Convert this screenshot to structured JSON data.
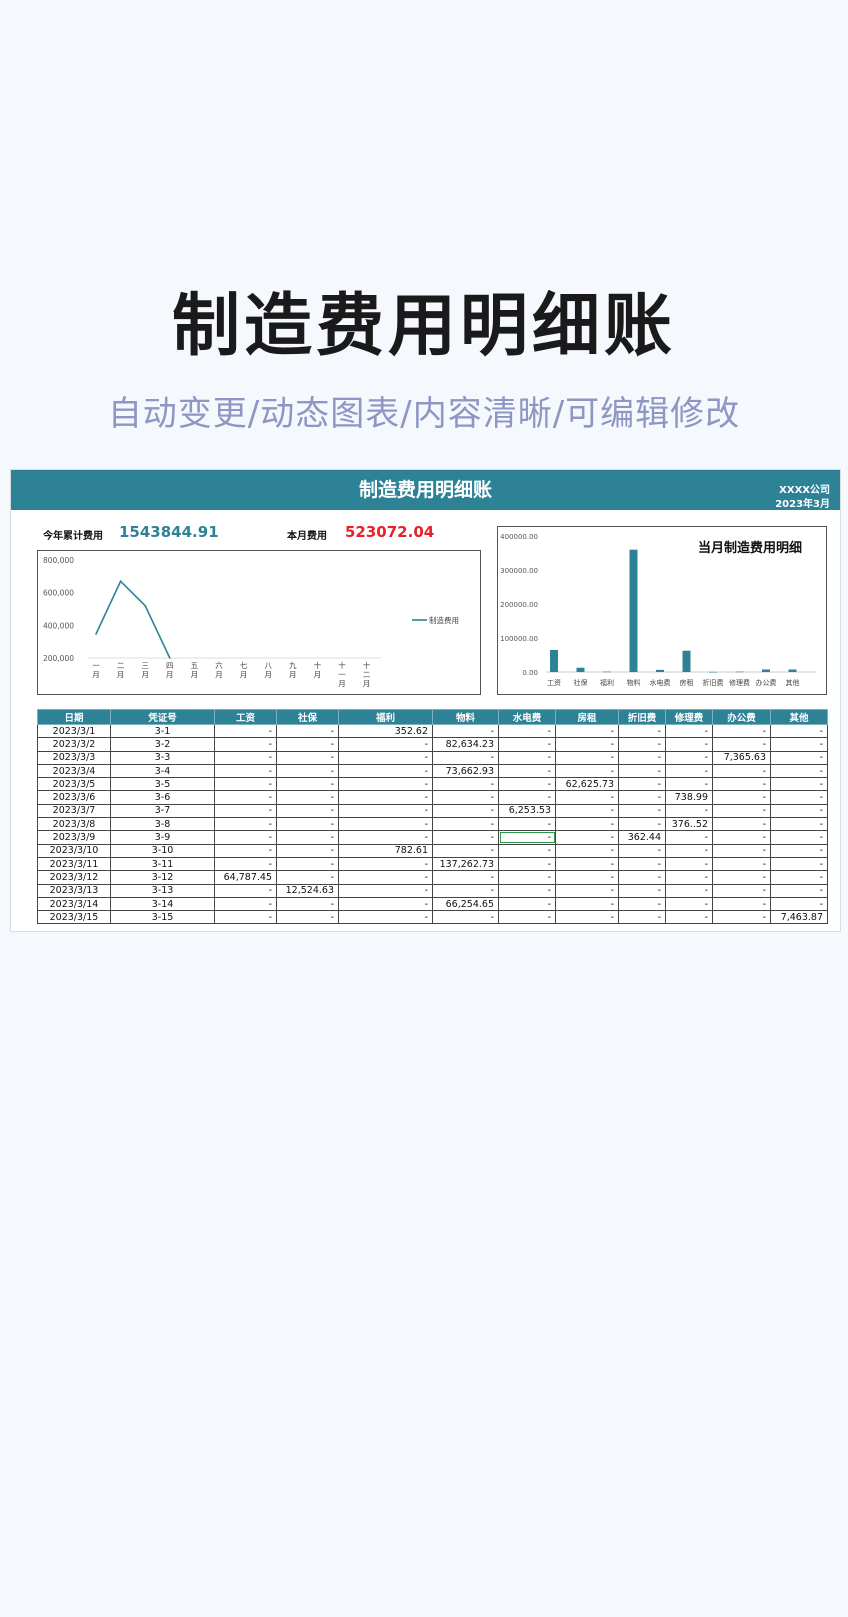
{
  "hero": {
    "title": "制造费用明细账",
    "subtitle": "自动变更/动态图表/内容清晰/可编辑修改"
  },
  "sheet": {
    "title": "制造费用明细账",
    "company": "XXXX公司",
    "period": "2023年3月",
    "ytd_label": "今年累计费用",
    "ytd_value": "1543844.91",
    "month_label": "本月费用",
    "month_value": "523072.04"
  },
  "colors": {
    "accent": "#2e8296",
    "month_value": "#e8202a",
    "ytd_value": "#2e8296"
  },
  "chart_data": [
    {
      "type": "line",
      "categories": [
        "一月",
        "二月",
        "三月",
        "四月",
        "五月",
        "六月",
        "七月",
        "八月",
        "九月",
        "十月",
        "十一月",
        "十二月"
      ],
      "category_lines": [
        [
          "一",
          "月"
        ],
        [
          "二",
          "月"
        ],
        [
          "三",
          "月"
        ],
        [
          "四",
          "月"
        ],
        [
          "五",
          "月"
        ],
        [
          "六",
          "月"
        ],
        [
          "七",
          "月"
        ],
        [
          "八",
          "月"
        ],
        [
          "九",
          "月"
        ],
        [
          "十",
          "月"
        ],
        [
          "十",
          "一",
          "月"
        ],
        [
          "十",
          "二",
          "月"
        ]
      ],
      "series": [
        {
          "name": "制造费用",
          "values": [
            347000,
            670000,
            520000,
            200000
          ]
        }
      ],
      "ylim": [
        200000,
        800000
      ],
      "yticks": [
        "200,000",
        "400,000",
        "600,000",
        "800,000"
      ],
      "legend": "right"
    },
    {
      "type": "bar",
      "title": "当月制造费用明细",
      "categories": [
        "工资",
        "社保",
        "福利",
        "物料",
        "水电费",
        "房租",
        "折旧费",
        "修理费",
        "办公费",
        "其他"
      ],
      "values": [
        64787.45,
        12524.63,
        1135.23,
        359814.51,
        6253.53,
        62625.73,
        362.44,
        1115.51,
        7365.63,
        7463.87
      ],
      "ylim": [
        0,
        400000
      ],
      "yticks": [
        "0.00",
        "100000.00",
        "200000.00",
        "300000.00",
        "400000.00"
      ]
    }
  ],
  "table": {
    "headers": [
      "日期",
      "凭证号",
      "工资",
      "社保",
      "福利",
      "物料",
      "水电费",
      "房租",
      "折旧费",
      "修理费",
      "办公费",
      "其他"
    ],
    "rows": [
      [
        "2023/3/1",
        "3-1",
        "-",
        "-",
        "352.62",
        "-",
        "-",
        "-",
        "-",
        "-",
        "-",
        "-"
      ],
      [
        "2023/3/2",
        "3-2",
        "-",
        "-",
        "-",
        "82,634.23",
        "-",
        "-",
        "-",
        "-",
        "-",
        "-"
      ],
      [
        "2023/3/3",
        "3-3",
        "-",
        "-",
        "-",
        "-",
        "-",
        "-",
        "-",
        "-",
        "7,365.63",
        "-"
      ],
      [
        "2023/3/4",
        "3-4",
        "-",
        "-",
        "-",
        "73,662.93",
        "-",
        "-",
        "-",
        "-",
        "-",
        "-"
      ],
      [
        "2023/3/5",
        "3-5",
        "-",
        "-",
        "-",
        "-",
        "-",
        "62,625.73",
        "-",
        "-",
        "-",
        "-"
      ],
      [
        "2023/3/6",
        "3-6",
        "-",
        "-",
        "-",
        "-",
        "-",
        "-",
        "-",
        "738.99",
        "-",
        "-"
      ],
      [
        "2023/3/7",
        "3-7",
        "-",
        "-",
        "-",
        "-",
        "6,253.53",
        "-",
        "-",
        "-",
        "-",
        "-"
      ],
      [
        "2023/3/8",
        "3-8",
        "-",
        "-",
        "-",
        "-",
        "-",
        "-",
        "-",
        "376..52",
        "-",
        "-"
      ],
      [
        "2023/3/9",
        "3-9",
        "-",
        "-",
        "-",
        "-",
        "-",
        "-",
        "362.44",
        "-",
        "-",
        "-"
      ],
      [
        "2023/3/10",
        "3-10",
        "-",
        "-",
        "782.61",
        "-",
        "-",
        "-",
        "-",
        "-",
        "-",
        "-"
      ],
      [
        "2023/3/11",
        "3-11",
        "-",
        "-",
        "-",
        "137,262.73",
        "-",
        "-",
        "-",
        "-",
        "-",
        "-"
      ],
      [
        "2023/3/12",
        "3-12",
        "64,787.45",
        "-",
        "-",
        "-",
        "-",
        "-",
        "-",
        "-",
        "-",
        "-"
      ],
      [
        "2023/3/13",
        "3-13",
        "-",
        "12,524.63",
        "-",
        "-",
        "-",
        "-",
        "-",
        "-",
        "-",
        "-"
      ],
      [
        "2023/3/14",
        "3-14",
        "-",
        "-",
        "-",
        "66,254.65",
        "-",
        "-",
        "-",
        "-",
        "-",
        "-"
      ],
      [
        "2023/3/15",
        "3-15",
        "-",
        "-",
        "-",
        "-",
        "-",
        "-",
        "-",
        "-",
        "-",
        "7,463.87"
      ]
    ]
  }
}
